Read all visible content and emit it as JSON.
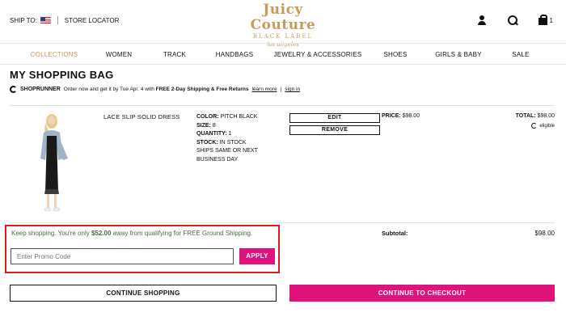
{
  "header": {
    "ship_to": "SHIP TO:",
    "store_locator": "STORE LOCATOR",
    "logo": {
      "line1": "Juicy Couture",
      "line2": "BLACK LABEL",
      "line3": "los angeles"
    },
    "bag_count": "1"
  },
  "nav": [
    "COLLECTIONS",
    "WOMEN",
    "TRACK",
    "HANDBAGS",
    "JEWELRY & ACCESSORIES",
    "SHOES",
    "GIRLS & BABY",
    "SALE"
  ],
  "page_title": "MY SHOPPING BAG",
  "shoprunner": {
    "brand": "SHOPRUNNER",
    "text_a": "Order now and get it by Tue Apr. 4 with ",
    "text_b": "FREE 2-Day Shipping & Free Returns",
    "learn_more": "learn more",
    "divider": "|",
    "sign_in": "sign in"
  },
  "item": {
    "name": "LACE SLIP SOLID DRESS",
    "color_label": "COLOR:",
    "color": "PITCH BLACK",
    "size_label": "SIZE:",
    "size": "8",
    "qty_label": "QUANTITY:",
    "qty": "1",
    "stock_label": "STOCK:",
    "stock": "IN STOCK",
    "ships": "SHIPS SAME OR NEXT BUSINESS DAY",
    "edit": "EDIT",
    "remove": "REMOVE",
    "price_label": "PRICE:",
    "price": "$98.00",
    "total_label": "TOTAL:",
    "total": "$98.00",
    "eligible": "eligible"
  },
  "promo": {
    "msg_a": "Keep shopping. You're only ",
    "amount": "$52.00",
    "msg_b": " away from qualifying for FREE Ground Shipping.",
    "placeholder": "Enter Promo Code",
    "apply": "APPLY"
  },
  "summary": {
    "subtotal_label": "Subtotal:",
    "subtotal": "$98.00"
  },
  "actions": {
    "continue": "CONTINUE SHOPPING",
    "checkout": "CONTINUE TO CHECKOUT"
  },
  "colors": {
    "accent_pink": "#e0127c",
    "gold": "#c89a5a",
    "promo_green": "#4a6b45",
    "highlight_red": "#e21b1b"
  }
}
